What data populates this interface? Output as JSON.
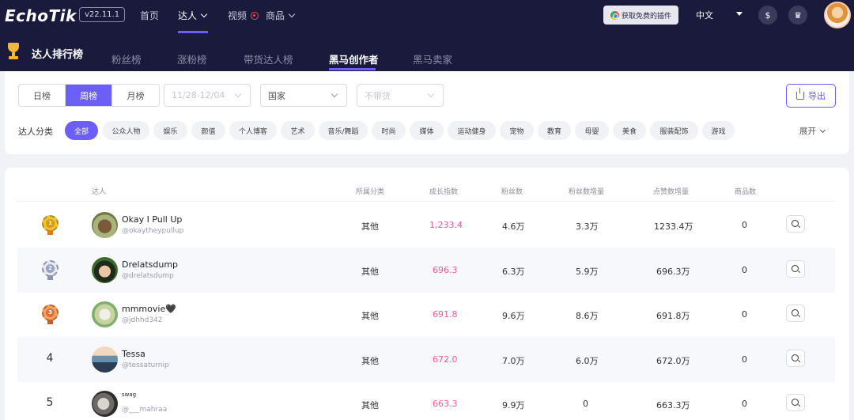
{
  "brand": {
    "logo_text": "EchoTik",
    "version": "v22.11.1"
  },
  "topnav": {
    "items": [
      {
        "label": "首页"
      },
      {
        "label": "达人",
        "active": true
      },
      {
        "label": "视频"
      },
      {
        "label": "商品"
      }
    ],
    "plugin_button": "获取免费的插件",
    "language": "中文",
    "icons": [
      "coin-icon",
      "crown-icon",
      "user-avatar"
    ]
  },
  "ranking": {
    "title": "达人排行榜",
    "tabs": [
      {
        "label": "粉丝榜"
      },
      {
        "label": "涨粉榜"
      },
      {
        "label": "带货达人榜"
      },
      {
        "label": "黑马创作者",
        "active": true
      },
      {
        "label": "黑马卖家"
      }
    ]
  },
  "filters": {
    "periods": [
      {
        "label": "日榜"
      },
      {
        "label": "周榜",
        "active": true
      },
      {
        "label": "月榜"
      }
    ],
    "date_range": "11/28-12/04",
    "country_placeholder": "国家",
    "selling_placeholder": "不带货",
    "export_label": "导出",
    "category_label": "达人分类",
    "categories": [
      "全部",
      "公众人物",
      "娱乐",
      "颜值",
      "个人博客",
      "艺术",
      "音乐/舞蹈",
      "时尚",
      "媒体",
      "运动健身",
      "宠物",
      "教育",
      "母婴",
      "美食",
      "服装配饰",
      "游戏"
    ],
    "expand_label": "展开"
  },
  "table": {
    "headers": [
      "达人",
      "所属分类",
      "成长指数",
      "粉丝数",
      "粉丝数增量",
      "点赞数增量",
      "商品数"
    ],
    "rows": [
      {
        "rank": "1",
        "medal": "gold",
        "name": "Okay I Pull Up",
        "handle": "@okaytheypullup",
        "category": "其他",
        "growth": "1,233.4",
        "followers": "4.6万",
        "follower_gain": "3.3万",
        "like_gain": "1233.4万",
        "products": "0"
      },
      {
        "rank": "2",
        "medal": "silver",
        "name": "Drelatsdump",
        "handle": "@drelatsdump",
        "category": "其他",
        "growth": "696.3",
        "followers": "6.3万",
        "follower_gain": "5.9万",
        "like_gain": "696.3万",
        "products": "0"
      },
      {
        "rank": "3",
        "medal": "bronze",
        "name": "mmmovie🖤",
        "handle": "@jdhhd342",
        "category": "其他",
        "growth": "691.8",
        "followers": "9.6万",
        "follower_gain": "8.6万",
        "like_gain": "691.8万",
        "products": "0"
      },
      {
        "rank": "4",
        "medal": null,
        "name": "Tessa",
        "handle": "@tessaturnip",
        "category": "其他",
        "growth": "672.0",
        "followers": "7.0万",
        "follower_gain": "6.0万",
        "like_gain": "672.0万",
        "products": "0"
      },
      {
        "rank": "5",
        "medal": null,
        "name": "swag",
        "handle": "@___mahraa",
        "category": "其他",
        "growth": "663.3",
        "followers": "9.9万",
        "follower_gain": "0",
        "like_gain": "663.3万",
        "products": "0"
      }
    ]
  },
  "colors": {
    "accent": "#6d5ef5",
    "nav_bg": "#191a3c",
    "growth": "#e95b9c"
  }
}
